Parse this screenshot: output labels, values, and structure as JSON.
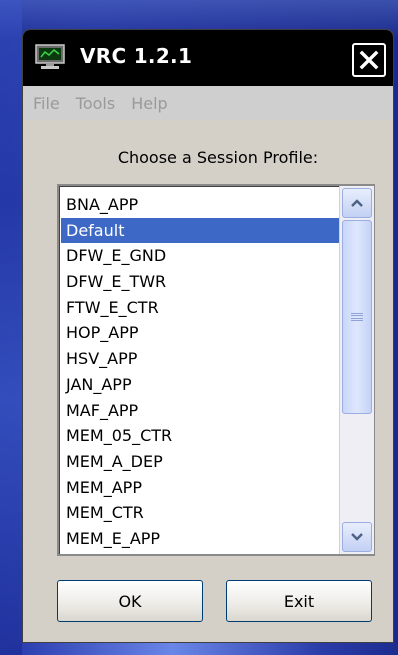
{
  "window": {
    "title": "VRC 1.2.1"
  },
  "menu": {
    "items": [
      "File",
      "Tools",
      "Help"
    ]
  },
  "prompt": "Choose a Session Profile:",
  "profiles": {
    "items": [
      "BNA_APP",
      "Default",
      "DFW_E_GND",
      "DFW_E_TWR",
      "FTW_E_CTR",
      "HOP_APP",
      "HSV_APP",
      "JAN_APP",
      "MAF_APP",
      "MEM_05_CTR",
      "MEM_A_DEP",
      "MEM_APP",
      "MEM_CTR",
      "MEM_E_APP"
    ],
    "selected": "Default"
  },
  "buttons": {
    "ok": "OK",
    "exit": "Exit"
  },
  "icons": {
    "app": "monitor-icon",
    "close": "close-icon",
    "scroll_up": "chevron-up-icon",
    "scroll_down": "chevron-down-icon",
    "scroll_grip": "grip-icon"
  },
  "colors": {
    "selection": "#3d68c5",
    "titlebar": "#000000",
    "dialog": "#d4d0c8",
    "desktop": "#1b2a8a"
  }
}
